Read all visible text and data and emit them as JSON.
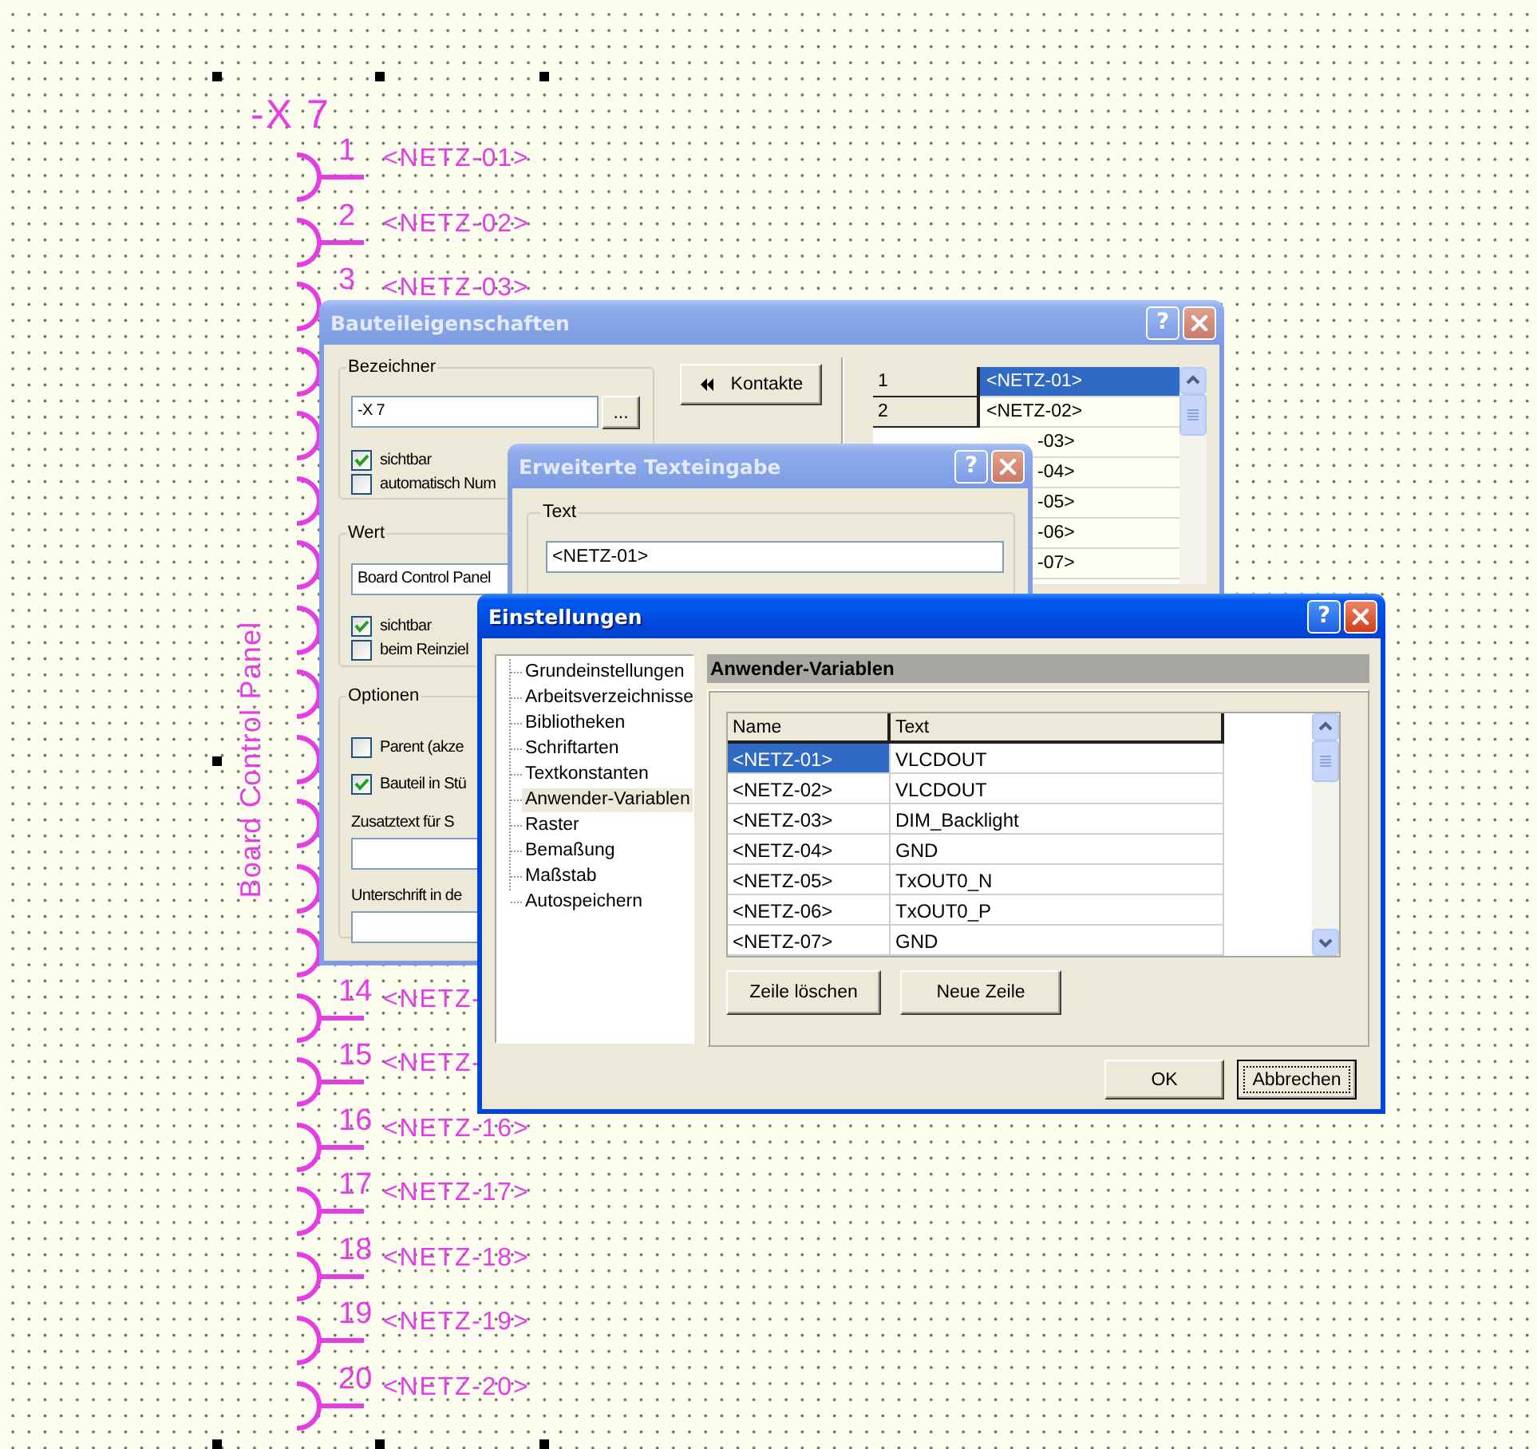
{
  "canvas": {
    "designator": "-X 7",
    "value_text": "Board Control Panel",
    "pins": [
      {
        "kind": "full",
        "number": "1",
        "label": "<NETZ-01>"
      },
      {
        "kind": "full",
        "number": "2",
        "label": "<NETZ-02>"
      },
      {
        "kind": "full",
        "number": "3",
        "label": "<NETZ-03>"
      },
      {
        "kind": "arc"
      },
      {
        "kind": "arc"
      },
      {
        "kind": "arc"
      },
      {
        "kind": "arc"
      },
      {
        "kind": "arc"
      },
      {
        "kind": "arc"
      },
      {
        "kind": "arc"
      },
      {
        "kind": "arc"
      },
      {
        "kind": "arc"
      },
      {
        "kind": "arc"
      },
      {
        "kind": "full",
        "number": "14",
        "label": "<NETZ-"
      },
      {
        "kind": "full",
        "number": "15",
        "label": "<NETZ-"
      },
      {
        "kind": "full",
        "number": "16",
        "label": "<NETZ-16>"
      },
      {
        "kind": "full",
        "number": "17",
        "label": "<NETZ-17>"
      },
      {
        "kind": "full",
        "number": "18",
        "label": "<NETZ-18>"
      },
      {
        "kind": "full",
        "number": "19",
        "label": "<NETZ-19>"
      },
      {
        "kind": "full",
        "number": "20",
        "label": "<NETZ-20>"
      }
    ]
  },
  "component_dialog": {
    "title": "Bauteileigenschaften",
    "active": false,
    "help": "?",
    "bezeichner": {
      "legend": "Bezeichner",
      "value": "-X 7",
      "browse": "...",
      "checks": [
        {
          "label": "sichtbar",
          "checked": true
        },
        {
          "label": "automatisch Num",
          "checked": false
        }
      ]
    },
    "wert": {
      "legend": "Wert",
      "value": "Board Control Panel",
      "checks": [
        {
          "label": "sichtbar",
          "checked": true
        },
        {
          "label": "beim Reinziel",
          "checked": false
        }
      ]
    },
    "optionen": {
      "legend": "Optionen",
      "checks": [
        {
          "label": "Parent (akze",
          "checked": false
        },
        {
          "label": "Bauteil in Stü",
          "checked": true
        }
      ],
      "fields": [
        {
          "label": "Zusatztext für S"
        },
        {
          "label": "Unterschrift in de"
        }
      ]
    },
    "kontakte_button": "Kontakte",
    "contacts": [
      {
        "kind": "full",
        "number": "1",
        "net": "<NETZ-01>",
        "selected": true
      },
      {
        "kind": "full",
        "number": "2",
        "net": "<NETZ-02>",
        "selected": false
      },
      {
        "kind": "covered",
        "net": "-03>",
        "selected": false
      },
      {
        "kind": "covered",
        "net": "-04>",
        "selected": false
      },
      {
        "kind": "covered",
        "net": "-05>",
        "selected": false
      },
      {
        "kind": "covered",
        "net": "-06>",
        "selected": false
      },
      {
        "kind": "covered",
        "net": "-07>",
        "selected": false
      }
    ]
  },
  "text_dialog": {
    "title": "Erweiterte Texteingabe",
    "active": false,
    "help": "?",
    "legend": "Text",
    "value": "<NETZ-01>"
  },
  "settings_dialog": {
    "title": "Einstellungen",
    "active": true,
    "help": "?",
    "tree": [
      {
        "label": "Grundeinstellungen",
        "selected": false
      },
      {
        "label": "Arbeitsverzeichnisse",
        "selected": false
      },
      {
        "label": "Bibliotheken",
        "selected": false
      },
      {
        "label": "Schriftarten",
        "selected": false
      },
      {
        "label": "Textkonstanten",
        "selected": false
      },
      {
        "label": "Anwender-Variablen",
        "selected": true
      },
      {
        "label": "Raster",
        "selected": false
      },
      {
        "label": "Bemaßung",
        "selected": false
      },
      {
        "label": "Maßstab",
        "selected": false
      },
      {
        "label": "Autospeichern",
        "selected": false
      }
    ],
    "section_title": "Anwender-Variablen",
    "columns": [
      "Name",
      "Text"
    ],
    "rows": [
      {
        "name": "<NETZ-01>",
        "text": "VLCDOUT",
        "selected": true
      },
      {
        "name": "<NETZ-02>",
        "text": "VLCDOUT",
        "selected": false
      },
      {
        "name": "<NETZ-03>",
        "text": "DIM_Backlight",
        "selected": false
      },
      {
        "name": "<NETZ-04>",
        "text": "GND",
        "selected": false
      },
      {
        "name": "<NETZ-05>",
        "text": "TxOUT0_N",
        "selected": false
      },
      {
        "name": "<NETZ-06>",
        "text": "TxOUT0_P",
        "selected": false
      },
      {
        "name": "<NETZ-07>",
        "text": "GND",
        "selected": false
      }
    ],
    "row_buttons": [
      "Zeile löschen",
      "Neue Zeile"
    ],
    "buttons": [
      {
        "label": "OK",
        "default": false
      },
      {
        "label": "Abbrechen",
        "default": true
      }
    ]
  }
}
